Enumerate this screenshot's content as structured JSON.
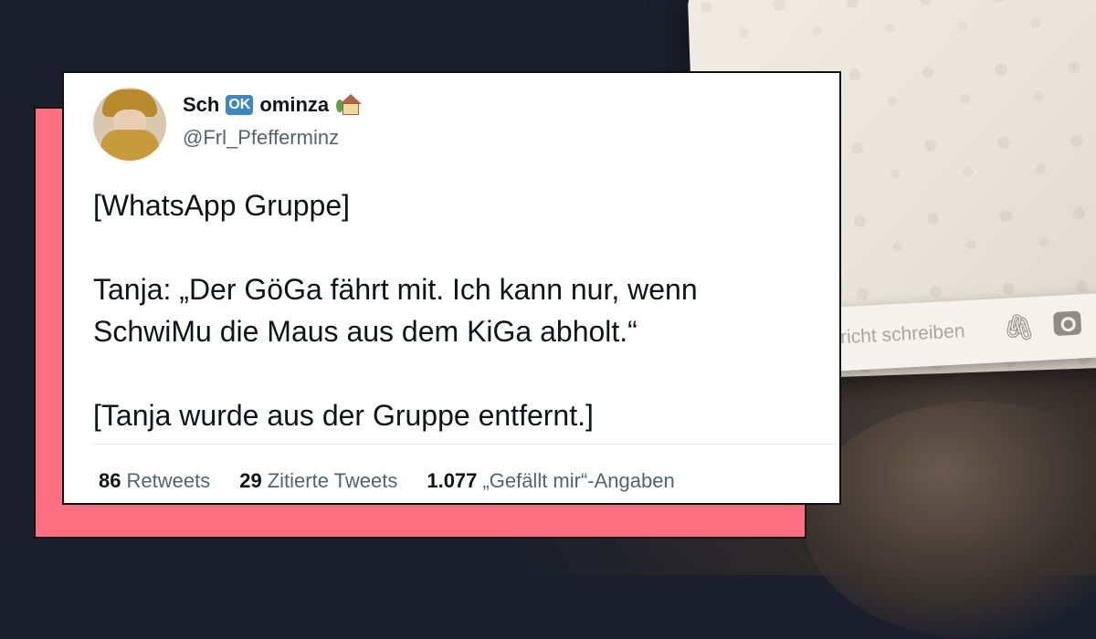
{
  "tweet": {
    "author_name_prefix": "Sch",
    "author_name_badge": "OK",
    "author_name_suffix": "ominza",
    "handle": "@Frl_Pfefferminz",
    "paragraphs": [
      "[WhatsApp Gruppe]",
      "Tanja: „Der GöGa fährt mit. Ich kann nur, wenn SchwiMu die Maus aus dem KiGa abholt.“",
      "[Tanja wurde aus der Gruppe entfernt.]"
    ],
    "stats": {
      "retweets_count": "86",
      "retweets_label": "Retweets",
      "quotes_count": "29",
      "quotes_label": "Zitierte Tweets",
      "likes_count": "1.077",
      "likes_label": "„Gefällt mir“-Angaben"
    }
  },
  "background": {
    "message_placeholder": "richt schreiben"
  },
  "colors": {
    "frame_accent": "#ff6f82",
    "page_background": "#1b1f2b",
    "ok_badge": "#3b88c3"
  },
  "icons": {
    "name_emoji": "house-with-garden-icon",
    "attach": "paperclip-icon",
    "camera": "camera-icon"
  }
}
